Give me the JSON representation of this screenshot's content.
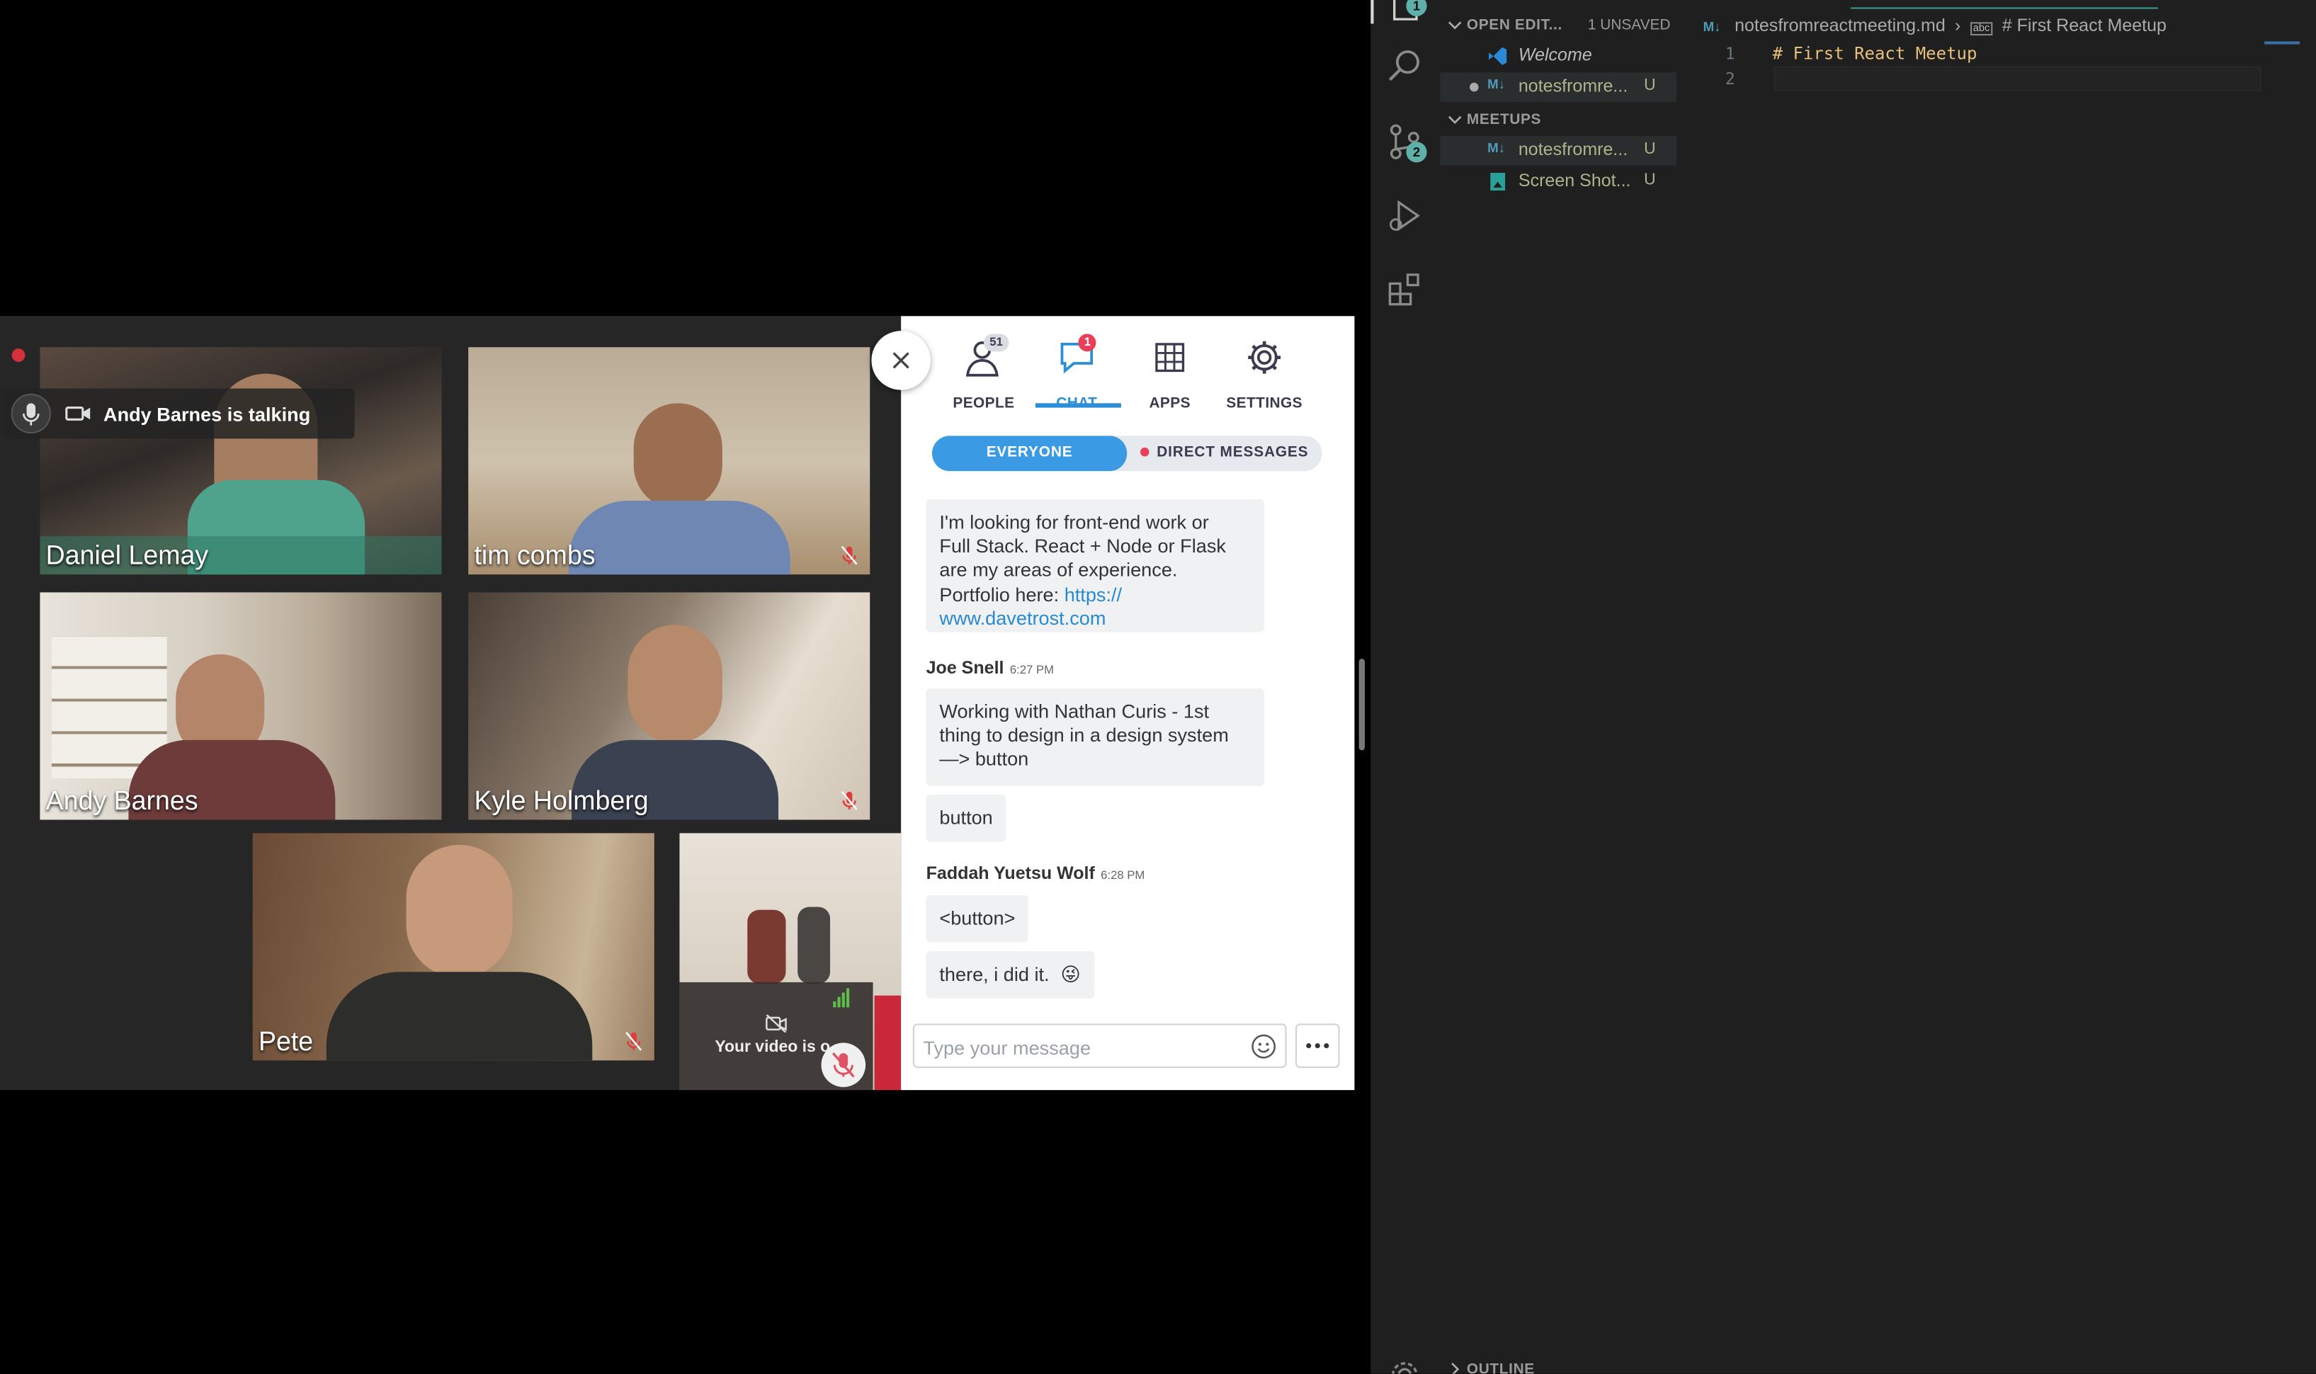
{
  "meeting": {
    "talking_indicator": "Andy Barnes is talking",
    "participants": [
      {
        "name": "Daniel Lemay",
        "muted": false
      },
      {
        "name": "tim combs",
        "muted": true
      },
      {
        "name": "Andy Barnes",
        "muted": false
      },
      {
        "name": "Kyle Holmberg",
        "muted": true
      },
      {
        "name": "Pete",
        "muted": true
      }
    ],
    "self_video_text": "Your video is o"
  },
  "panel": {
    "tabs": [
      {
        "label": "PEOPLE",
        "badge": "51"
      },
      {
        "label": "CHAT",
        "badge": "1",
        "active": true
      },
      {
        "label": "APPS"
      },
      {
        "label": "SETTINGS"
      }
    ],
    "segments": {
      "everyone": "EVERYONE",
      "direct": "DIRECT MESSAGES"
    },
    "messages": {
      "m1_line1": "I'm looking for front-end work or",
      "m1_line2": "Full Stack. React + Node or Flask",
      "m1_line3": "are my areas of experience.",
      "m1_line4": "Portfolio here: ",
      "m1_link1": "https://",
      "m1_link2": "www.davetrost.com",
      "s2_name": "Joe Snell",
      "s2_time": "6:27 PM",
      "m2_line1": "Working with Nathan Curis - 1st",
      "m2_line2": "thing to design in a design system",
      "m2_line3": "—> button",
      "m3": "button",
      "s3_name": "Faddah Yuetsu Wolf",
      "s3_time": "6:28 PM",
      "m4": "<button>",
      "m5": "there, i did it.",
      "m5_emoji": "😜"
    },
    "input_placeholder": "Type your message"
  },
  "vscode": {
    "explorer_badge": "1",
    "scm_badge": "2",
    "open_editors": "OPEN EDIT...",
    "unsaved": "1 UNSAVED",
    "open_files": [
      {
        "icon": "vscode-icon",
        "name": "Welcome",
        "status": ""
      },
      {
        "icon": "markdown-icon",
        "name": "notesfromre...",
        "status": "U"
      }
    ],
    "folder": "MEETUPS",
    "folder_files": [
      {
        "icon": "markdown-icon",
        "name": "notesfromre...",
        "status": "U"
      },
      {
        "icon": "image-icon",
        "name": "Screen Shot...",
        "status": "U"
      }
    ],
    "outline": "OUTLINE",
    "breadcrumb_file": "notesfromreactmeeting.md",
    "breadcrumb_symbol": "# First React Meetup",
    "lines": [
      {
        "num": "1",
        "text": "# First React Meetup"
      },
      {
        "num": "2",
        "text": ""
      }
    ]
  },
  "colors": {
    "accent": "#2b8ed6",
    "badge_red": "#e8405a",
    "vscode_modified": "#aab58c"
  }
}
